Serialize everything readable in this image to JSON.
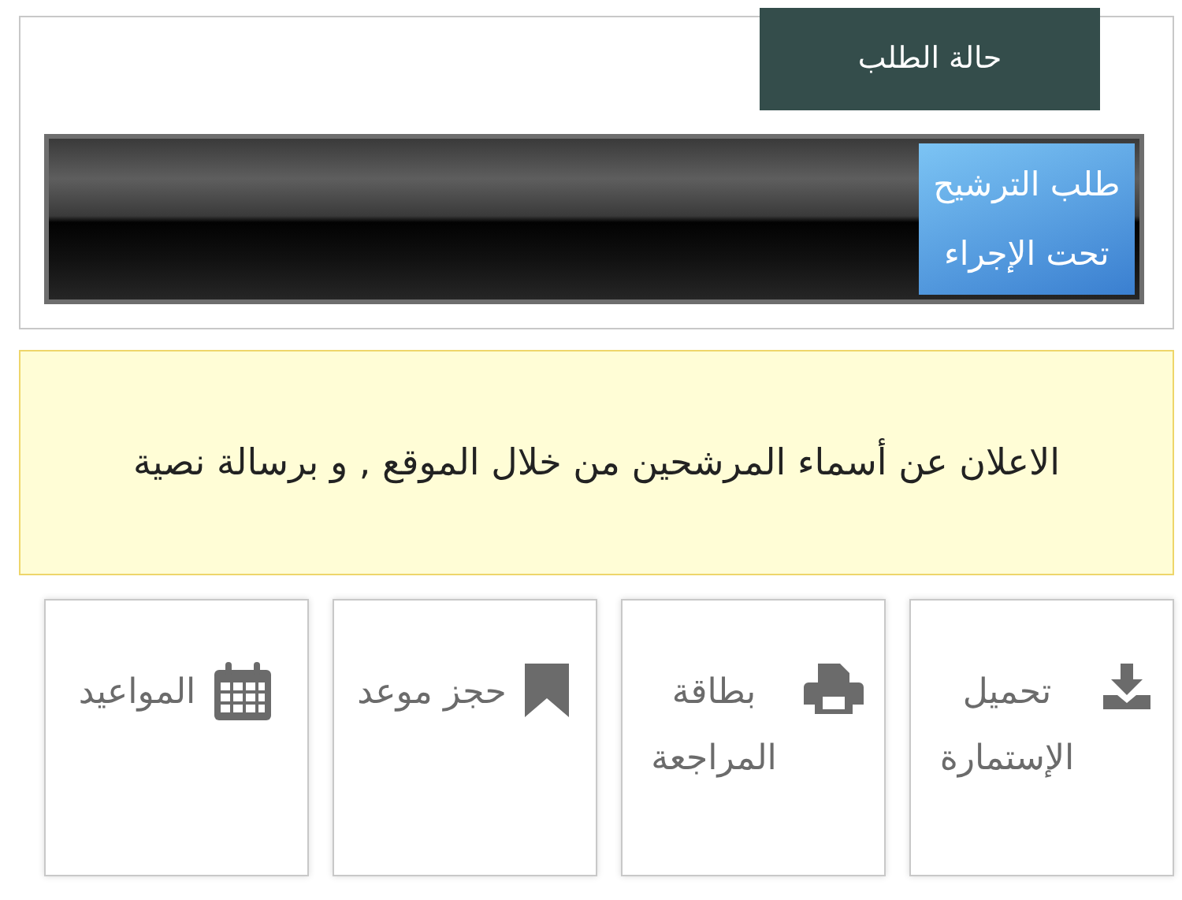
{
  "status_panel": {
    "tab": {
      "label": "حالة الطلب",
      "selected": true
    },
    "progress": {
      "label": "طلب الترشيح تحت الإجراء",
      "level": 0.2
    }
  },
  "notice": "الاعلان عن أسماء المرشحين من خلال الموقع , و برسالة نصية",
  "actions": [
    {
      "kind": "download",
      "label": "تحميل الإستمارة"
    },
    {
      "kind": "print",
      "label": "بطاقة المراجعة"
    },
    {
      "kind": "bookmark",
      "label": "حجز موعد"
    },
    {
      "kind": "calendar",
      "label": "المواعيد"
    }
  ]
}
